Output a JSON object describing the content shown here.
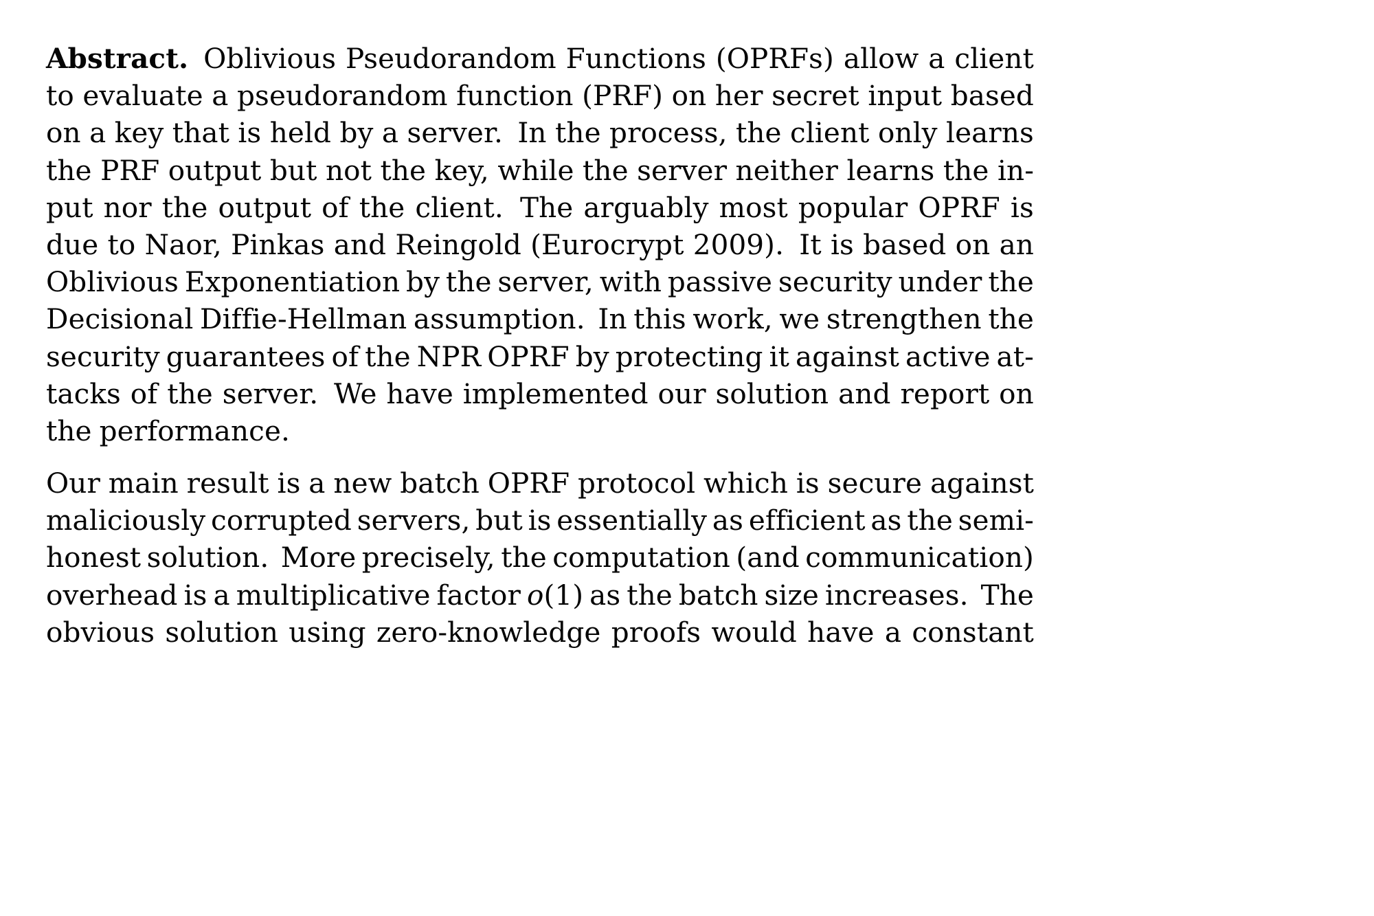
{
  "document": {
    "type": "academic-paper-abstract",
    "background_color": "#ffffff",
    "text_color": "#050505",
    "paragraphs": [
      {
        "id": "abstract",
        "lead_label": "Abstract.",
        "full_text": "Abstract.  Oblivious Pseudorandom Functions (OPRFs) allow a client to evaluate a pseudorandom function (PRF) on her secret input based on a key that is held by a server.  In the process, the client only learns the PRF output but not the key, while the server neither learns the input nor the output of the client.  The arguably most popular OPRF is due to Naor, Pinkas and Reingold (Eurocrypt 2009).  It is based on an Oblivious Exponentiation by the server, with passive security under the Decisional Diffie-Hellman assumption.  In this work, we strengthen the security guarantees of the NPR OPRF by protecting it against active attacks of the server.  We have implemented our solution and report on the performance.",
        "lines": [
          {
            "justify": true,
            "words": [
              {
                "t": "Abstract.",
                "bold": true
              },
              {
                "t": "Oblivious"
              },
              {
                "t": "Pseudorandom"
              },
              {
                "t": "Functions"
              },
              {
                "t": "(OPRFs)"
              },
              {
                "t": "allow"
              },
              {
                "t": "a"
              },
              {
                "t": "client"
              }
            ]
          },
          {
            "justify": true,
            "words": [
              {
                "t": "to"
              },
              {
                "t": "evaluate"
              },
              {
                "t": "a"
              },
              {
                "t": "pseudorandom"
              },
              {
                "t": "function"
              },
              {
                "t": "(PRF)"
              },
              {
                "t": "on"
              },
              {
                "t": "her"
              },
              {
                "t": "secret"
              },
              {
                "t": "input"
              },
              {
                "t": "based"
              }
            ]
          },
          {
            "justify": true,
            "words": [
              {
                "t": "on"
              },
              {
                "t": "a"
              },
              {
                "t": "key"
              },
              {
                "t": "that"
              },
              {
                "t": "is"
              },
              {
                "t": "held"
              },
              {
                "t": "by"
              },
              {
                "t": "a"
              },
              {
                "t": "server."
              },
              {
                "t": "In"
              },
              {
                "t": "the"
              },
              {
                "t": "process,"
              },
              {
                "t": "the"
              },
              {
                "t": "client"
              },
              {
                "t": "only"
              },
              {
                "t": "learns"
              }
            ]
          },
          {
            "justify": true,
            "words": [
              {
                "t": "the"
              },
              {
                "t": "PRF"
              },
              {
                "t": "output"
              },
              {
                "t": "but"
              },
              {
                "t": "not"
              },
              {
                "t": "the"
              },
              {
                "t": "key,"
              },
              {
                "t": "while"
              },
              {
                "t": "the"
              },
              {
                "t": "server"
              },
              {
                "t": "neither"
              },
              {
                "t": "learns"
              },
              {
                "t": "the"
              },
              {
                "t": "in-"
              }
            ]
          },
          {
            "justify": true,
            "words": [
              {
                "t": "put"
              },
              {
                "t": "nor"
              },
              {
                "t": "the"
              },
              {
                "t": "output"
              },
              {
                "t": "of"
              },
              {
                "t": "the"
              },
              {
                "t": "client."
              },
              {
                "t": "The"
              },
              {
                "t": "arguably"
              },
              {
                "t": "most"
              },
              {
                "t": "popular"
              },
              {
                "t": "OPRF"
              },
              {
                "t": "is"
              }
            ]
          },
          {
            "justify": true,
            "words": [
              {
                "t": "due"
              },
              {
                "t": "to"
              },
              {
                "t": "Naor,"
              },
              {
                "t": "Pinkas"
              },
              {
                "t": "and"
              },
              {
                "t": "Reingold"
              },
              {
                "t": "(Eurocrypt"
              },
              {
                "t": "2009)."
              },
              {
                "t": "It"
              },
              {
                "t": "is"
              },
              {
                "t": "based"
              },
              {
                "t": "on"
              },
              {
                "t": "an"
              }
            ]
          },
          {
            "justify": true,
            "words": [
              {
                "t": "Oblivious"
              },
              {
                "t": "Exponentiation"
              },
              {
                "t": "by"
              },
              {
                "t": "the"
              },
              {
                "t": "server,"
              },
              {
                "t": "with"
              },
              {
                "t": "passive"
              },
              {
                "t": "security"
              },
              {
                "t": "under"
              },
              {
                "t": "the"
              }
            ]
          },
          {
            "justify": true,
            "words": [
              {
                "t": "Decisional"
              },
              {
                "t": "Diffie-Hellman"
              },
              {
                "t": "assumption."
              },
              {
                "t": "In"
              },
              {
                "t": "this"
              },
              {
                "t": "work,"
              },
              {
                "t": "we"
              },
              {
                "t": "strengthen"
              },
              {
                "t": "the"
              }
            ]
          },
          {
            "justify": true,
            "words": [
              {
                "t": "security"
              },
              {
                "t": "guarantees"
              },
              {
                "t": "of"
              },
              {
                "t": "the"
              },
              {
                "t": "NPR"
              },
              {
                "t": "OPRF"
              },
              {
                "t": "by"
              },
              {
                "t": "protecting"
              },
              {
                "t": "it"
              },
              {
                "t": "against"
              },
              {
                "t": "active"
              },
              {
                "t": "at-"
              }
            ]
          },
          {
            "justify": true,
            "words": [
              {
                "t": "tacks"
              },
              {
                "t": "of"
              },
              {
                "t": "the"
              },
              {
                "t": "server."
              },
              {
                "t": "We"
              },
              {
                "t": "have"
              },
              {
                "t": "implemented"
              },
              {
                "t": "our"
              },
              {
                "t": "solution"
              },
              {
                "t": "and"
              },
              {
                "t": "report"
              },
              {
                "t": "on"
              }
            ]
          },
          {
            "justify": false,
            "words": [
              {
                "t": "the"
              },
              {
                "t": "performance."
              }
            ]
          }
        ]
      },
      {
        "id": "main-result",
        "full_text": "Our main result is a new batch OPRF protocol which is secure against maliciously corrupted servers, but is essentially as efficient as the semi-honest solution. More precisely, the computation (and communication) overhead is a multiplicative factor o(1) as the batch size increases. The obvious solution using zero-knowledge proofs would have a constant",
        "lines": [
          {
            "justify": true,
            "words": [
              {
                "t": "Our"
              },
              {
                "t": "main"
              },
              {
                "t": "result"
              },
              {
                "t": "is"
              },
              {
                "t": "a"
              },
              {
                "t": "new"
              },
              {
                "t": "batch"
              },
              {
                "t": "OPRF"
              },
              {
                "t": "protocol"
              },
              {
                "t": "which"
              },
              {
                "t": "is"
              },
              {
                "t": "secure"
              },
              {
                "t": "against"
              }
            ]
          },
          {
            "justify": true,
            "words": [
              {
                "t": "maliciously"
              },
              {
                "t": "corrupted"
              },
              {
                "t": "servers,"
              },
              {
                "t": "but"
              },
              {
                "t": "is"
              },
              {
                "t": "essentially"
              },
              {
                "t": "as"
              },
              {
                "t": "efficient"
              },
              {
                "t": "as"
              },
              {
                "t": "the"
              },
              {
                "t": "semi-"
              }
            ]
          },
          {
            "justify": true,
            "words": [
              {
                "t": "honest"
              },
              {
                "t": "solution."
              },
              {
                "t": "More"
              },
              {
                "t": "precisely,"
              },
              {
                "t": "the"
              },
              {
                "t": "computation"
              },
              {
                "t": "(and"
              },
              {
                "t": "communication)"
              }
            ]
          },
          {
            "justify": true,
            "words": [
              {
                "t": "overhead"
              },
              {
                "t": "is"
              },
              {
                "t": "a"
              },
              {
                "t": "multiplicative"
              },
              {
                "t": "factor"
              },
              {
                "t": "o(1)",
                "math": true,
                "math_var": "o",
                "math_arg": "(1)"
              },
              {
                "t": "as"
              },
              {
                "t": "the"
              },
              {
                "t": "batch"
              },
              {
                "t": "size"
              },
              {
                "t": "increases."
              },
              {
                "t": "The"
              }
            ]
          },
          {
            "justify": true,
            "words": [
              {
                "t": "obvious"
              },
              {
                "t": "solution"
              },
              {
                "t": "using"
              },
              {
                "t": "zero-knowledge"
              },
              {
                "t": "proofs"
              },
              {
                "t": "would"
              },
              {
                "t": "have"
              },
              {
                "t": "a"
              },
              {
                "t": "constant"
              }
            ]
          }
        ]
      }
    ]
  }
}
